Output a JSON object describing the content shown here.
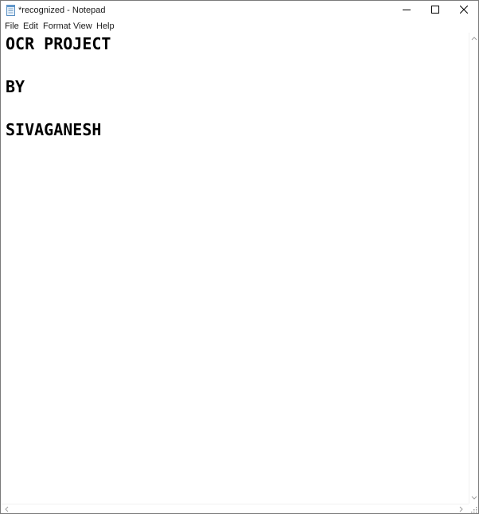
{
  "window": {
    "title": "*recognized - Notepad"
  },
  "menu": {
    "items": [
      "File",
      "Edit",
      "Format",
      "View",
      "Help"
    ]
  },
  "editor": {
    "lines": [
      "OCR PROJECT",
      "",
      "BY",
      "",
      "SIVAGANESH"
    ]
  },
  "colors": {
    "window_border": "#7a7a7a",
    "text": "#000000",
    "background": "#ffffff"
  },
  "icons": {
    "app": "notepad-icon",
    "minimize": "minimize-icon",
    "maximize": "maximize-icon",
    "close": "close-icon"
  }
}
